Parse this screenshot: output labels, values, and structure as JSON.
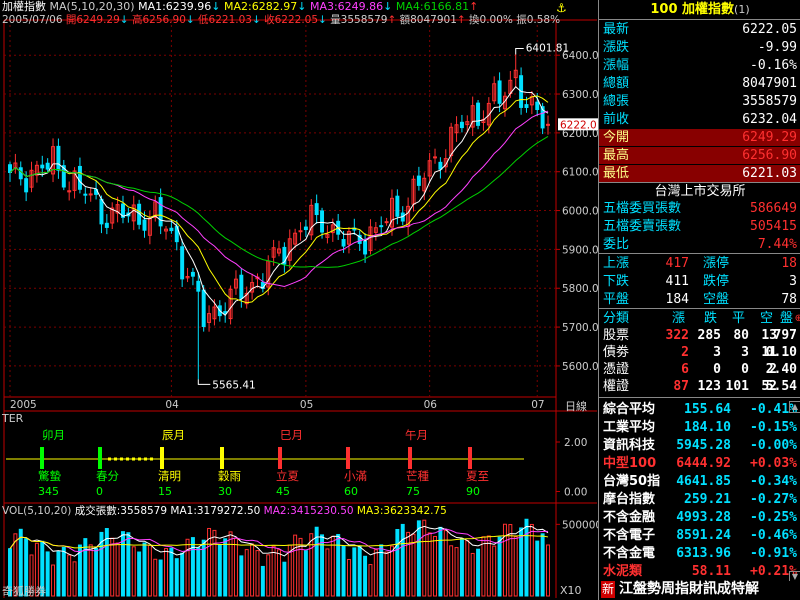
{
  "header": {
    "title": "加權指數",
    "ma_label": "MA(5,10,20,30)",
    "ma1": "MA1:6239.96",
    "ma1_arrow": "↓",
    "ma2": "MA2:6282.97",
    "ma2_arrow": "↓",
    "ma3": "MA3:6249.86",
    "ma3_arrow": "↓",
    "ma4": "MA4:6166.81",
    "ma4_arrow": "↑",
    "date": "2005/07/06",
    "open": "開6249.29",
    "open_arrow": "↓",
    "high": "高6256.90",
    "high_arrow": "↓",
    "low": "低6221.03",
    "low_arrow": "↓",
    "close": "收6222.05",
    "close_arrow": "↓",
    "vol": "量3558579",
    "vol_arrow": "↑",
    "amount": "額8047901",
    "amount_arrow": "↑",
    "turnover": "換0.00%",
    "amp": "振0.58%"
  },
  "colors": {
    "up": "#ff3030",
    "down": "#00e0ff",
    "ma1": "#ffffff",
    "ma2": "#ffff00",
    "ma3": "#ff40ff",
    "ma4": "#00d000",
    "grid": "#7a0000",
    "axis": "#c00000"
  },
  "chart_data": [
    {
      "type": "candlestick",
      "title": "加權指數",
      "ylim": [
        5520,
        6470
      ],
      "yticks": [
        "6400.0",
        "6300.0",
        "6200.0",
        "6100.0",
        "6000.0",
        "5900.0",
        "5800.0",
        "5700.0",
        "5600.0"
      ],
      "xticks": [
        "2005",
        "04",
        "05",
        "06",
        "07"
      ],
      "xtick_pos": [
        0,
        30,
        55,
        78,
        98
      ],
      "n_bars": 101,
      "annotations": {
        "high": "6401.81",
        "low": "5565.41",
        "last": "6222.0"
      },
      "corner_label": "日線"
    },
    {
      "type": "indicator",
      "name": "TER",
      "ylim": [
        0,
        3
      ],
      "yticks": [
        "2.00",
        "0.00"
      ],
      "months": [
        "卯月",
        "辰月",
        "巳月",
        "午月"
      ],
      "terms": [
        {
          "name": "驚蟄",
          "value": "345"
        },
        {
          "name": "春分",
          "value": "0"
        },
        {
          "name": "清明",
          "value": "15"
        },
        {
          "name": "穀雨",
          "value": "30"
        },
        {
          "name": "立夏",
          "value": "45"
        },
        {
          "name": "小滿",
          "value": "60"
        },
        {
          "name": "芒種",
          "value": "75"
        },
        {
          "name": "夏至",
          "value": "90"
        }
      ]
    },
    {
      "type": "bar",
      "title": "VOL(5,10,20)",
      "legend": {
        "vol": "成交張數:3558579",
        "ma1": "MA1:3179272.50",
        "ma2": "MA2:3415230.50",
        "ma3": "MA3:3623342.75"
      },
      "yticks": [
        "500000"
      ],
      "unit": "X10",
      "ylim": [
        0,
        6000000
      ]
    }
  ],
  "footer": {
    "brand": "奇狐勝券"
  },
  "quote": {
    "code_title": "100 加權指數",
    "badge": "(1)",
    "rows": [
      {
        "label": "最新",
        "value": "6222.05"
      },
      {
        "label": "漲跌",
        "value": "-9.99"
      },
      {
        "label": "漲幅",
        "value": "-0.16%"
      },
      {
        "label": "總額",
        "value": "8047901"
      },
      {
        "label": "總張",
        "value": "3558579"
      },
      {
        "label": "前收",
        "value": "6232.04"
      },
      {
        "label": "今開",
        "value": "6249.29"
      },
      {
        "label": "最高",
        "value": "6256.90"
      },
      {
        "label": "最低",
        "value": "6221.03"
      }
    ],
    "exchange": "台灣上市交易所",
    "wudang": [
      {
        "label": "五檔委買張數",
        "value": "586649"
      },
      {
        "label": "五檔委賣張數",
        "value": "505415"
      },
      {
        "label": "委比",
        "value": "7.44%"
      }
    ],
    "breadth": [
      {
        "l1": "上漲",
        "v1": "417",
        "l2": "漲停",
        "v2": "18"
      },
      {
        "l1": "下跌",
        "v1": "411",
        "l2": "跌停",
        "v2": "3"
      },
      {
        "l1": "平盤",
        "v1": "184",
        "l2": "空盤",
        "v2": "78"
      }
    ],
    "cat_header": [
      "分類",
      "漲",
      "跌",
      "平",
      "空",
      "盤"
    ],
    "cat_rows": [
      {
        "name": "股票",
        "up": "322",
        "down": "285",
        "flat": "80",
        "empty": "13",
        "total": "797"
      },
      {
        "name": "債劵",
        "up": "2",
        "down": "3",
        "flat": "3",
        "empty": "11",
        "total": "0.10"
      },
      {
        "name": "憑證",
        "up": "6",
        "down": "0",
        "flat": "0",
        "empty": "2",
        "total": "2.40"
      },
      {
        "name": "權證",
        "up": "87",
        "down": "123",
        "flat": "101",
        "empty": "52",
        "total": "5.54"
      }
    ],
    "indices": [
      {
        "name": "綜合平均",
        "value": "155.64",
        "chg": "-0.41%"
      },
      {
        "name": "工業平均",
        "value": "184.10",
        "chg": "-0.15%"
      },
      {
        "name": "資訊科技",
        "value": "5945.28",
        "chg": "-0.00%"
      },
      {
        "name": "中型100",
        "value": "6444.92",
        "chg": "+0.03%"
      },
      {
        "name": "台灣50指",
        "value": "4641.85",
        "chg": "-0.34%"
      },
      {
        "name": "摩台指數",
        "value": "259.21",
        "chg": "-0.27%"
      },
      {
        "name": "不含金融",
        "value": "4993.28",
        "chg": "-0.25%"
      },
      {
        "name": "不含電子",
        "value": "8591.24",
        "chg": "-0.46%"
      },
      {
        "name": "不含金電",
        "value": "6313.96",
        "chg": "-0.91%"
      },
      {
        "name": "水泥類",
        "value": "58.11",
        "chg": "+0.21%"
      }
    ],
    "ticker": "江盤勢周指財訊成特解",
    "ticker_tag": "新"
  }
}
